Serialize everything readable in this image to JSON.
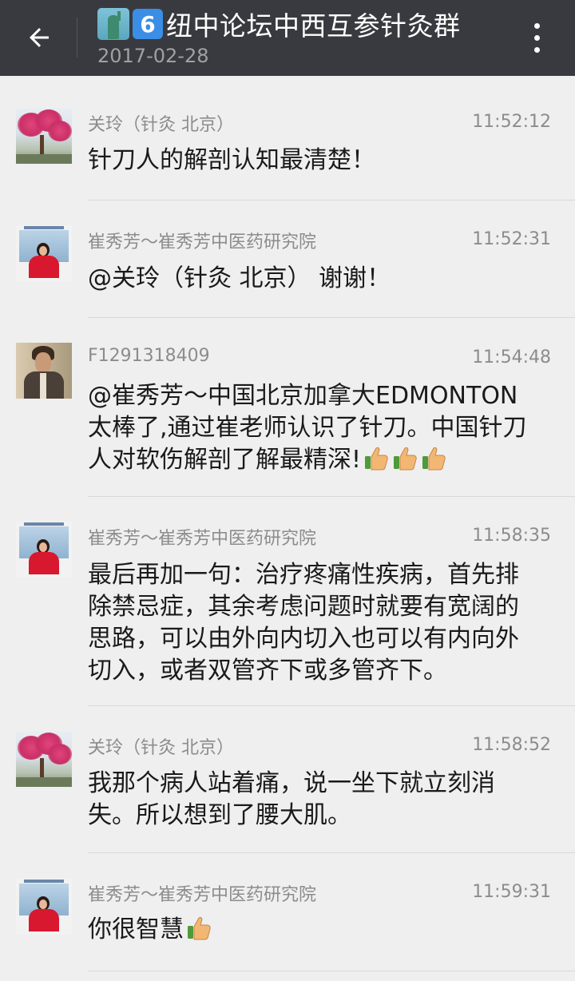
{
  "header": {
    "title": "纽中论坛中西互参针灸群",
    "date": "2017-02-28",
    "title_emojis": [
      "statue-of-liberty",
      "keycap-6"
    ],
    "bg_color": "#393a3f"
  },
  "messages": [
    {
      "sender": "关玲（针灸 北京）",
      "time": "11:52:12",
      "text": "针刀人的解剖认知最清楚！",
      "thumbs": 0,
      "avatar": "blossom-tree"
    },
    {
      "sender": "崔秀芳～崔秀芳中医药研究院",
      "time": "11:52:31",
      "text": "@关玲（针灸 北京） 谢谢！",
      "thumbs": 0,
      "avatar": "woman-red"
    },
    {
      "sender": "F1291318409",
      "time": "11:54:48",
      "text": "@崔秀芳～中国北京加拿大EDMONTON 太棒了,通过崔老师认识了针刀。中国针刀人对软伤解剖了解最精深!",
      "thumbs": 3,
      "avatar": "man-portrait"
    },
    {
      "sender": "崔秀芳～崔秀芳中医药研究院",
      "time": "11:58:35",
      "text": "最后再加一句：治疗疼痛性疾病，首先排除禁忌症，其余考虑问题时就要有宽阔的思路，可以由外向内切入也可以有内向外切入，或者双管齐下或多管齐下。",
      "thumbs": 0,
      "avatar": "woman-red"
    },
    {
      "sender": "关玲（针灸 北京）",
      "time": "11:58:52",
      "text": "我那个病人站着痛，说一坐下就立刻消失。所以想到了腰大肌。",
      "thumbs": 0,
      "avatar": "blossom-tree"
    },
    {
      "sender": "崔秀芳～崔秀芳中医药研究院",
      "time": "11:59:31",
      "text": "你很智慧",
      "thumbs": 1,
      "avatar": "woman-red"
    }
  ]
}
